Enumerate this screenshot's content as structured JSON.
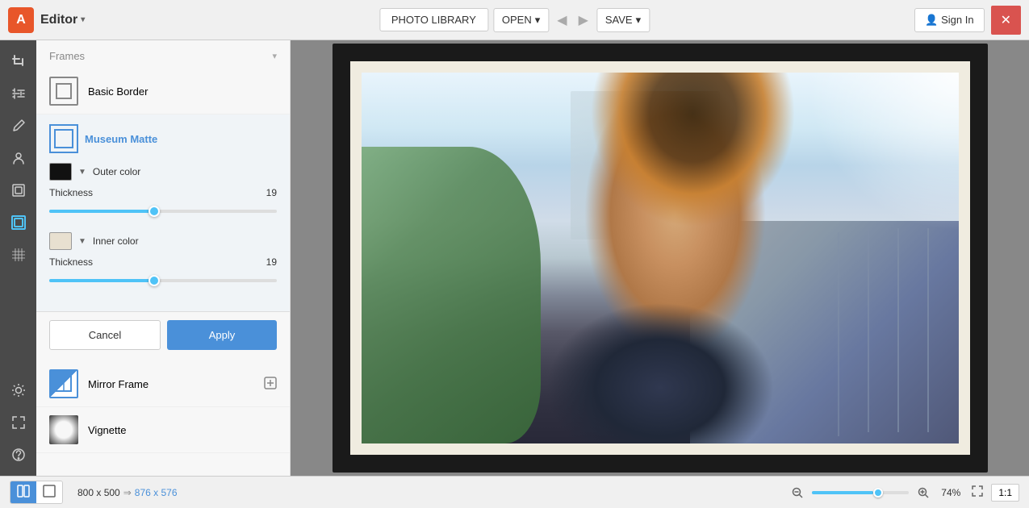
{
  "app": {
    "logo": "A",
    "editor_title": "Editor",
    "editor_chevron": "▾"
  },
  "topbar": {
    "photo_library": "PHOTO LIBRARY",
    "open": "OPEN",
    "open_chevron": "▾",
    "undo": "◀",
    "redo": "▶",
    "save": "SAVE",
    "save_chevron": "▾",
    "sign_in": "Sign In",
    "close": "✕"
  },
  "panel": {
    "frames_header": "Frames",
    "frames_chevron": "▾",
    "basic_border_label": "Basic Border",
    "museum_matte_label": "Museum Matte",
    "outer_color_label": "Outer color",
    "outer_color": "#111111",
    "inner_color_label": "Inner color",
    "inner_color": "#e8e0d0",
    "thickness_label": "Thickness",
    "outer_thickness_value": "19",
    "inner_thickness_value": "19",
    "outer_slider_percent": 46,
    "inner_slider_percent": 46,
    "cancel_label": "Cancel",
    "apply_label": "Apply",
    "mirror_frame_label": "Mirror Frame",
    "vignette_label": "Vignette"
  },
  "bottom_bar": {
    "original_dims": "800 x 500",
    "arrow": "⇒",
    "new_dims": "876 x 576",
    "zoom_percent": "74%",
    "zoom_ratio": "1:1"
  },
  "icons": {
    "crop": "⊞",
    "wand": "✦",
    "brush": "✎",
    "person": "◉",
    "layers": "❑",
    "border": "□",
    "texture": "≋",
    "light": "☀",
    "expand": "⤢",
    "question": "?",
    "zoom_out": "−",
    "zoom_in": "+",
    "fullscreen": "⛶",
    "view_split": "⊟",
    "view_single": "□"
  }
}
